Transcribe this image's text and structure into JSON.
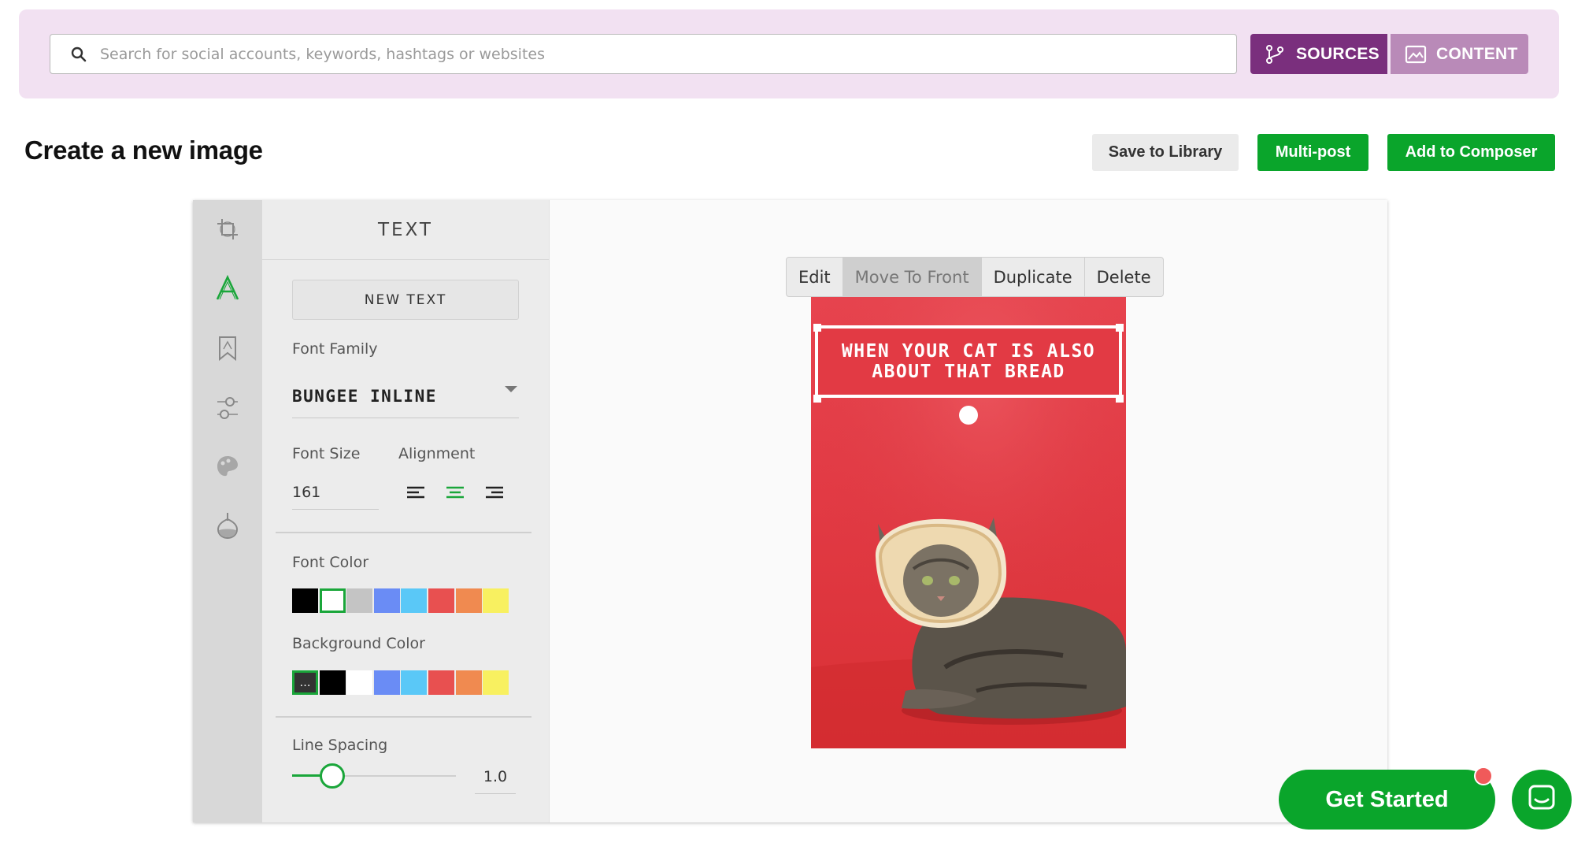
{
  "search": {
    "placeholder": "Search for social accounts, keywords, hashtags or websites",
    "icon": "search-icon"
  },
  "view_toggle": {
    "sources_label": "SOURCES",
    "content_label": "CONTENT"
  },
  "header": {
    "title": "Create a new image",
    "save_label": "Save to Library",
    "multipost_label": "Multi-post",
    "composer_label": "Add to Composer"
  },
  "tools": [
    "crop-icon",
    "text-icon",
    "sticker-icon",
    "adjust-icon",
    "palette-icon",
    "drop-icon"
  ],
  "panel": {
    "title": "TEXT",
    "new_text_label": "NEW TEXT",
    "font_family_label": "Font Family",
    "font_family_value": "BUNGEE INLINE",
    "font_size_label": "Font Size",
    "font_size_value": "161",
    "alignment_label": "Alignment",
    "alignment_selected": "center",
    "font_color_label": "Font Color",
    "font_colors": [
      "#000000",
      "#ffffff",
      "#c4c4c4",
      "#6a8cf5",
      "#5ac8f7",
      "#e85050",
      "#f08a50",
      "#f8f060"
    ],
    "font_color_selected": "#ffffff",
    "background_color_label": "Background Color",
    "background_colors": [
      "#333333",
      "#000000",
      "#ffffff",
      "#6a8cf5",
      "#5ac8f7",
      "#e85050",
      "#f08a50",
      "#f8f060"
    ],
    "line_spacing_label": "Line Spacing",
    "line_spacing_value": "1.0"
  },
  "context_menu": {
    "edit": "Edit",
    "move_to_front": "Move To Front",
    "duplicate": "Duplicate",
    "delete": "Delete"
  },
  "poster": {
    "line1": "WHEN YOUR CAT IS ALSO",
    "line2": "ABOUT THAT BREAD",
    "background": "#e23a44"
  },
  "cta": {
    "get_started": "Get Started"
  },
  "colors": {
    "brand_purple": "#7a2f7d",
    "accent_green": "#0aa52b"
  }
}
